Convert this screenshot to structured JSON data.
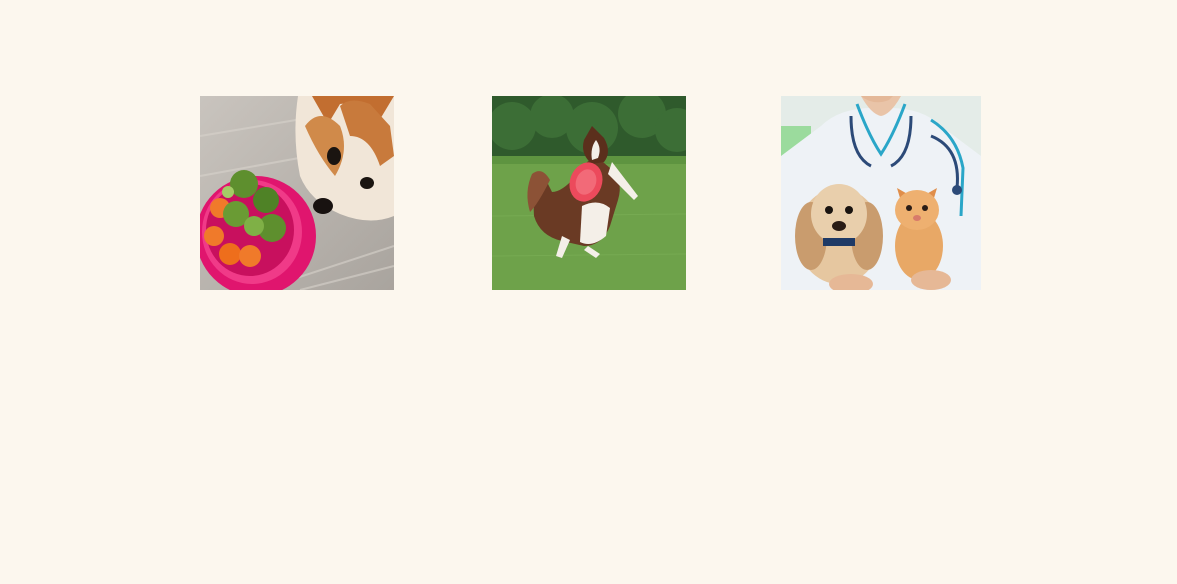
{
  "page": {
    "background": "#fcf7ee"
  },
  "tiles": [
    {
      "id": "nutrition",
      "icon": "dog-food-bowl-photo",
      "colors": {
        "bowl": "#e0156e",
        "fur": "#c87a3c",
        "floor": "#b7b2ac"
      }
    },
    {
      "id": "exercise",
      "icon": "dog-frisbee-photo",
      "colors": {
        "grass": "#6ea24a",
        "trees": "#2f5a2c",
        "frisbee": "#ec4a5c"
      }
    },
    {
      "id": "vet",
      "icon": "vet-puppy-kitten-photo",
      "colors": {
        "coat": "#eef2f6",
        "trim": "#2aa6c8",
        "puppy": "#d9b892",
        "kitten": "#e8a866"
      }
    }
  ]
}
